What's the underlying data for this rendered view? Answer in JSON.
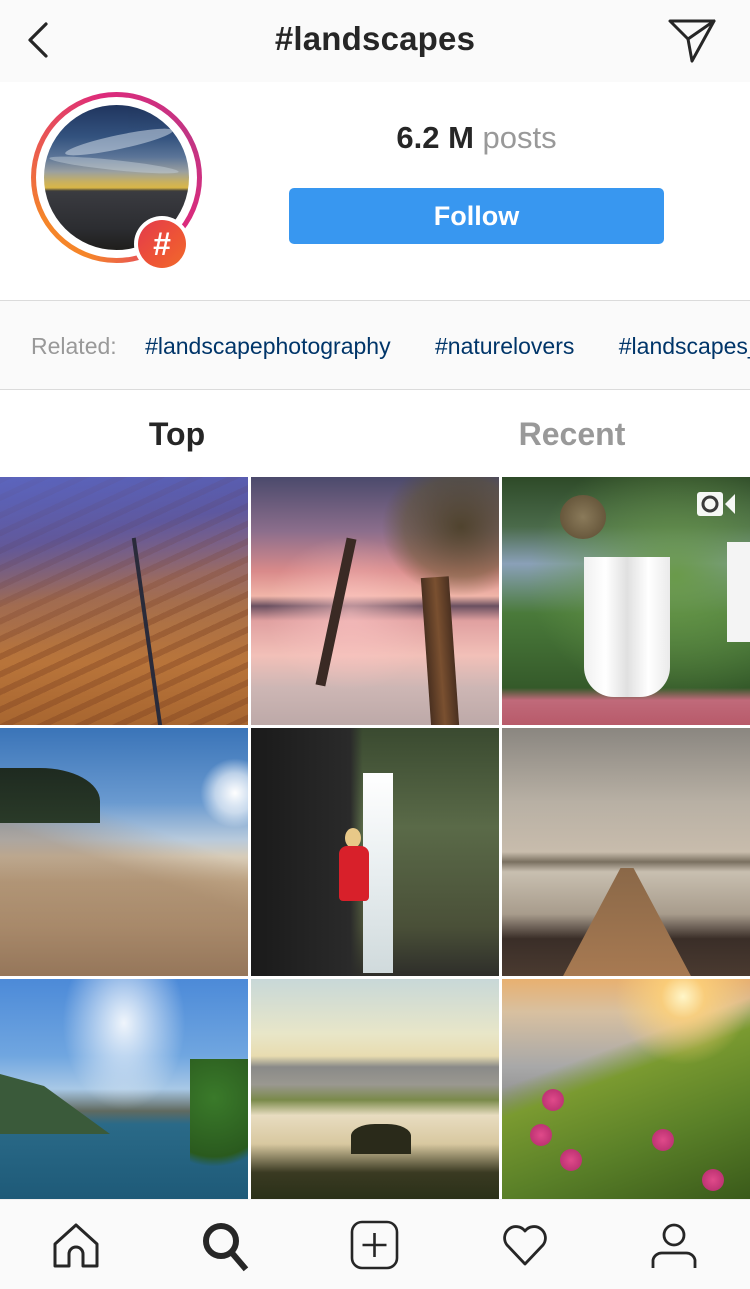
{
  "header": {
    "title": "#landscapes",
    "back_icon": "chevron-left-icon",
    "direct_icon": "paper-plane-icon"
  },
  "profile": {
    "avatar_alt": "Hashtag top post photo (sunset over sea)",
    "badge_symbol": "#",
    "posts_count": "6.2 M",
    "posts_label": "posts",
    "follow_label": "Follow"
  },
  "related": {
    "label": "Related:",
    "tags": [
      "#landscapephotography",
      "#naturelovers",
      "#landscapes_captures"
    ]
  },
  "tabs": [
    {
      "label": "Top",
      "active": true
    },
    {
      "label": "Recent",
      "active": false
    }
  ],
  "grid": {
    "posts": [
      {
        "description": "Aerial view of desert farmland with a long road",
        "is_video": false
      },
      {
        "description": "Palm trees at a pink sunset beach",
        "is_video": false
      },
      {
        "description": "Garden terrace with white curtains",
        "is_video": true
      },
      {
        "description": "Sand dunes beach under blue sky",
        "is_video": false
      },
      {
        "description": "Woman in red dress on swing near waterfall",
        "is_video": false
      },
      {
        "description": "Long dinner table on pier by the sea",
        "is_video": false
      },
      {
        "description": "Lake with mountains and clouds",
        "is_video": false
      },
      {
        "description": "Misty Tuscany hills at sunrise",
        "is_video": false
      },
      {
        "description": "Cliffside meadow with pink flowers at sunset",
        "is_video": false
      }
    ]
  },
  "bottom_nav": [
    {
      "name": "home",
      "icon": "home-icon",
      "active": false
    },
    {
      "name": "search",
      "icon": "search-icon",
      "active": true
    },
    {
      "name": "new-post",
      "icon": "plus-square-icon",
      "active": false
    },
    {
      "name": "activity",
      "icon": "heart-icon",
      "active": false
    },
    {
      "name": "profile",
      "icon": "person-icon",
      "active": false
    }
  ],
  "colors": {
    "follow_button": "#3897f0",
    "related_tag": "#003569",
    "muted_text": "#999999",
    "primary_text": "#262626",
    "ring_gradient": [
      "#f58529",
      "#dd2a7b",
      "#c13584"
    ]
  }
}
